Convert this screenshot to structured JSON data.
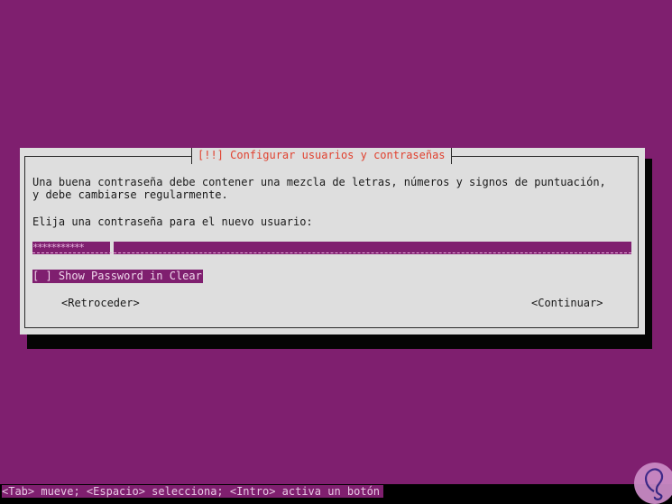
{
  "dialog": {
    "title": "[!!] Configurar usuarios y contraseñas",
    "description_line1": "Una buena contraseña debe contener una mezcla de letras, números y signos de puntuación,",
    "description_line2": "y debe cambiarse regularmente.",
    "prompt": "Elija una contraseña para el nuevo usuario:",
    "password_field": {
      "masked_value": "***********",
      "placeholder": ""
    },
    "show_password_checkbox": {
      "label": "[ ] Show Password in Clear",
      "checked": false
    },
    "buttons": {
      "back": "<Retroceder>",
      "continue": "<Continuar>"
    }
  },
  "statusbar": {
    "help_text": "<Tab> mueve; <Espacio> selecciona; <Intro> activa un botón"
  },
  "colors": {
    "background": "#7f1f6f",
    "dialog": "#dedede",
    "title": "#e0412f",
    "highlight": "#7f1f6f"
  },
  "watermark": {
    "icon": "logo-icon"
  }
}
